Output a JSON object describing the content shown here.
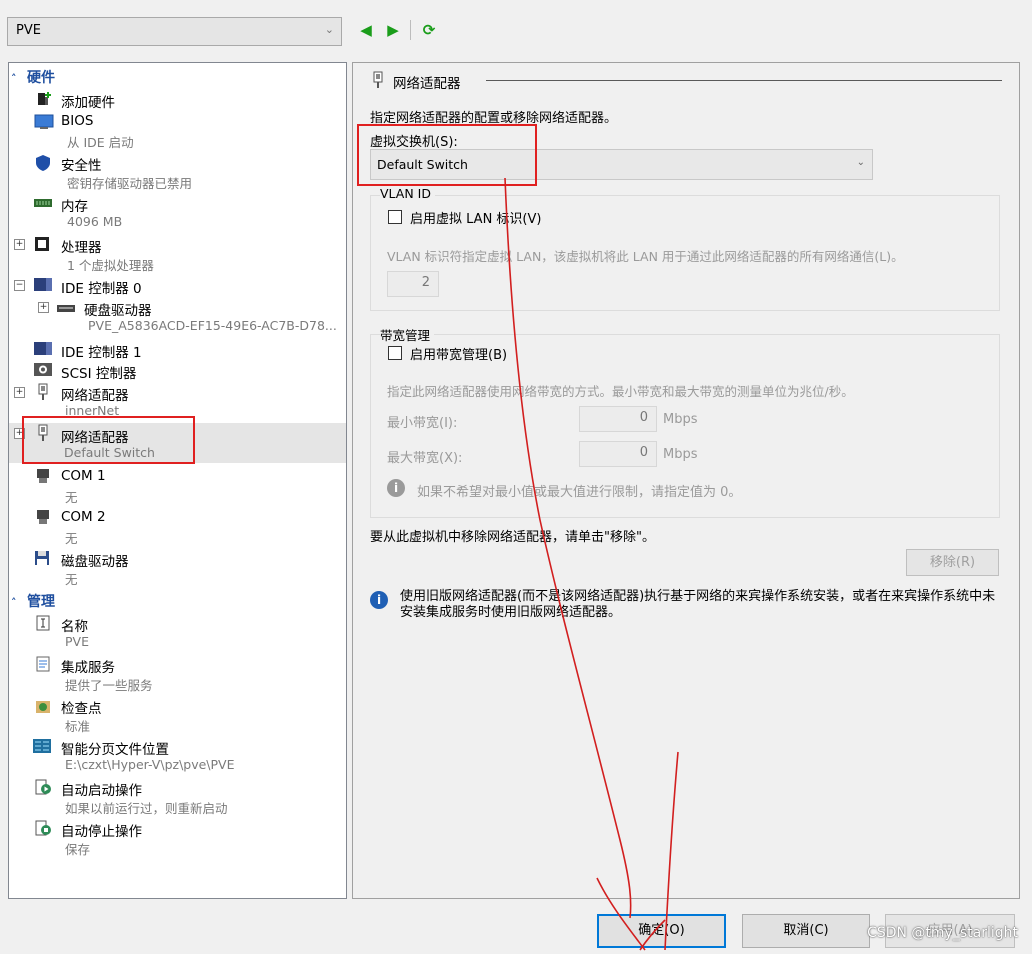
{
  "top": {
    "vm_name": "PVE",
    "nav_icons": [
      "back-icon",
      "forward-icon",
      "refresh-icon"
    ]
  },
  "sections": {
    "hardware": "硬件",
    "management": "管理"
  },
  "tree": [
    {
      "name": "add-hardware",
      "title": "添加硬件",
      "sub": ""
    },
    {
      "name": "bios",
      "title": "BIOS",
      "sub": "从 IDE 启动"
    },
    {
      "name": "security",
      "title": "安全性",
      "sub": "密钥存储驱动器已禁用"
    },
    {
      "name": "memory",
      "title": "内存",
      "sub": "4096 MB"
    },
    {
      "name": "processor",
      "title": "处理器",
      "sub": "1 个虚拟处理器"
    },
    {
      "name": "ide-controller-0",
      "title": "IDE 控制器 0",
      "sub": ""
    },
    {
      "name": "hard-drive",
      "title": "硬盘驱动器",
      "sub": "PVE_A5836ACD-EF15-49E6-AC7B-D78..."
    },
    {
      "name": "ide-controller-1",
      "title": "IDE 控制器 1",
      "sub": ""
    },
    {
      "name": "scsi-controller",
      "title": "SCSI 控制器",
      "sub": ""
    },
    {
      "name": "network-adapter-1",
      "title": "网络适配器",
      "sub": "innerNet"
    },
    {
      "name": "network-adapter-2",
      "title": "网络适配器",
      "sub": "Default Switch"
    },
    {
      "name": "com1",
      "title": "COM 1",
      "sub": "无"
    },
    {
      "name": "com2",
      "title": "COM 2",
      "sub": "无"
    },
    {
      "name": "floppy",
      "title": "磁盘驱动器",
      "sub": "无"
    },
    {
      "name": "vm-name",
      "title": "名称",
      "sub": "PVE"
    },
    {
      "name": "integration-services",
      "title": "集成服务",
      "sub": "提供了一些服务"
    },
    {
      "name": "checkpoints",
      "title": "检查点",
      "sub": "标准"
    },
    {
      "name": "smart-paging",
      "title": "智能分页文件位置",
      "sub": "E:\\czxt\\Hyper-V\\pz\\pve\\PVE"
    },
    {
      "name": "auto-start",
      "title": "自动启动操作",
      "sub": "如果以前运行过，则重新启动"
    },
    {
      "name": "auto-stop",
      "title": "自动停止操作",
      "sub": "保存"
    }
  ],
  "right": {
    "title": "网络适配器",
    "desc": "指定网络适配器的配置或移除网络适配器。",
    "switch_label": "虚拟交换机(S):",
    "switch_value": "Default Switch",
    "vlan": {
      "group": "VLAN ID",
      "checkbox": "启用虚拟 LAN 标识(V)",
      "desc": "VLAN 标识符指定虚拟 LAN，该虚拟机将此 LAN 用于通过此网络适配器的所有网络通信(L)。",
      "value": "2"
    },
    "bandwidth": {
      "group": "带宽管理",
      "checkbox": "启用带宽管理(B)",
      "desc": "指定此网络适配器使用网络带宽的方式。最小带宽和最大带宽的测量单位为兆位/秒。",
      "min_label": "最小带宽(I):",
      "min_value": "0",
      "max_label": "最大带宽(X):",
      "max_value": "0",
      "unit": "Mbps",
      "hint": "如果不希望对最小值或最大值进行限制，请指定值为 0。"
    },
    "remove_text": "要从此虚拟机中移除网络适配器，请单击\"移除\"。",
    "remove_button": "移除(R)",
    "legacy_info": "使用旧版网络适配器(而不是该网络适配器)执行基于网络的来宾操作系统安装，或者在来宾操作系统中未安装集成服务时使用旧版网络适配器。"
  },
  "footer": {
    "ok": "确定(O)",
    "cancel": "取消(C)",
    "apply": "应用(A)"
  },
  "watermark": "CSDN @tmy_starlight"
}
